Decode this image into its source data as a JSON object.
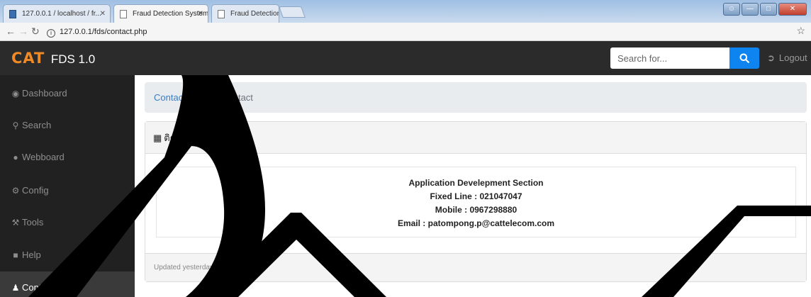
{
  "browser": {
    "tabs": [
      {
        "title": "127.0.0.1 / localhost / fr..."
      },
      {
        "title": "Fraud Detection System"
      },
      {
        "title": "Fraud Detection System"
      }
    ],
    "url": "127.0.0.1/fds/contact.php"
  },
  "navbar": {
    "brand_logo": "CAT",
    "brand_name": "FDS 1.0",
    "search_placeholder": "Search for...",
    "logout_label": "Logout"
  },
  "sidebar": {
    "items": [
      {
        "label": "Dashboard",
        "icon": "dashboard-icon"
      },
      {
        "label": "Search",
        "icon": "search-icon"
      },
      {
        "label": "Webboard",
        "icon": "comment-icon"
      },
      {
        "label": "Config",
        "icon": "gear-icon"
      },
      {
        "label": "Tools",
        "icon": "wrench-icon"
      },
      {
        "label": "Help",
        "icon": "book-icon"
      },
      {
        "label": "Contact us",
        "icon": "user-icon"
      }
    ]
  },
  "breadcrumb": {
    "parent": "Contact",
    "separator": "/",
    "current": "Fraud contact"
  },
  "card": {
    "header": "ติดต่อผู้ดูแลระบบ",
    "lines": [
      "Application Develepment Section",
      "Fixed Line : 021047047",
      "Mobile : 0967298880",
      "Email : patompong.p@cattelecom.com"
    ],
    "footer": "Updated yesterday at 11:59 PM"
  },
  "colors": {
    "navbar": "#2b2b2b",
    "sidebar": "#212121",
    "accent": "#0d84ef",
    "brand": "#f08a24"
  }
}
